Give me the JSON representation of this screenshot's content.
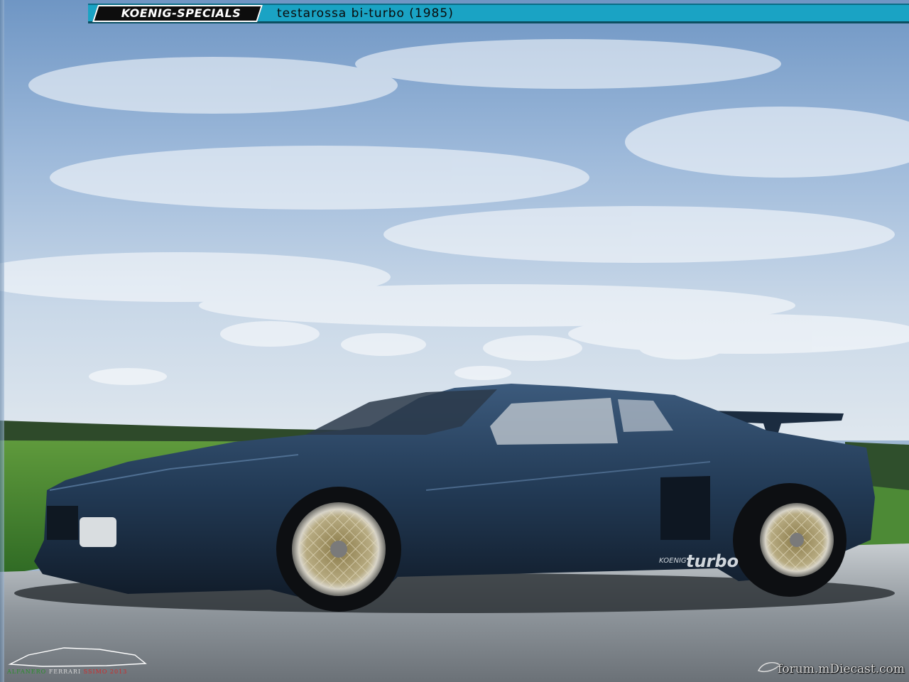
{
  "header": {
    "brand": "KOENIG-SPECIALS",
    "model": "testarossa bi-turbo",
    "year": "(1985)"
  },
  "car": {
    "side_badge_brand": "KOENIG",
    "side_badge_model": "turbo",
    "body_color": "#223a55"
  },
  "credits": {
    "left_part1": "ALFANERO",
    "left_part2": "FERRARI",
    "left_part3": "SSIMO 2013",
    "right": "forum.mDiecast.com"
  }
}
